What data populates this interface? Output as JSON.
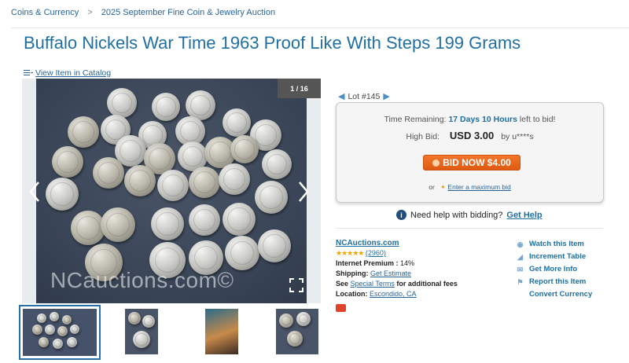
{
  "breadcrumb": {
    "items": [
      "Coins & Currency",
      "2025 September Fine Coin & Jewelry Auction"
    ],
    "separator": ">"
  },
  "title": "Buffalo Nickels War Time 1963 Proof Like With Steps 199 Grams",
  "catalog_link": "View Item in Catalog",
  "gallery": {
    "counter": "1 / 16",
    "watermark": "NCauctions.com©",
    "prev_icon": "chevron-left-icon",
    "next_icon": "chevron-right-icon",
    "fullscreen_icon": "expand-icon"
  },
  "lot": {
    "label": "Lot #145"
  },
  "bid": {
    "time_label": "Time Remaining:",
    "time_value": "17 Days 10 Hours",
    "time_suffix": "left to bid!",
    "high_bid_label": "High Bid:",
    "high_bid_value": "USD 3.00",
    "bidder": "by u****s",
    "button_label": "BID NOW $4.00",
    "or_text": "or",
    "max_bid_link": "Enter a maximum bid"
  },
  "help": {
    "text": "Need help with bidding?",
    "link": "Get Help"
  },
  "seller": {
    "name": "NCAuctions.com",
    "rating_count": "(2960)",
    "premium_label": "Internet Premium :",
    "premium_value": "14%",
    "shipping_label": "Shipping:",
    "shipping_link": "Get Estimate",
    "terms_prefix": "See",
    "terms_link": "Special Terms",
    "terms_suffix": "for additional fees",
    "location_label": "Location:",
    "location_link": "Escondido, CA"
  },
  "actions": [
    {
      "label": "Watch this Item",
      "icon": "eye-icon"
    },
    {
      "label": "Increment Table",
      "icon": "bar-chart-icon"
    },
    {
      "label": "Get More Info",
      "icon": "envelope-icon"
    },
    {
      "label": "Report this Item",
      "icon": "flag-icon"
    },
    {
      "label": "Convert Currency",
      "icon": ""
    }
  ],
  "colors": {
    "link": "#1f6fa0",
    "bid_button": "#e8641a",
    "rating_stars": "#f0a500"
  }
}
